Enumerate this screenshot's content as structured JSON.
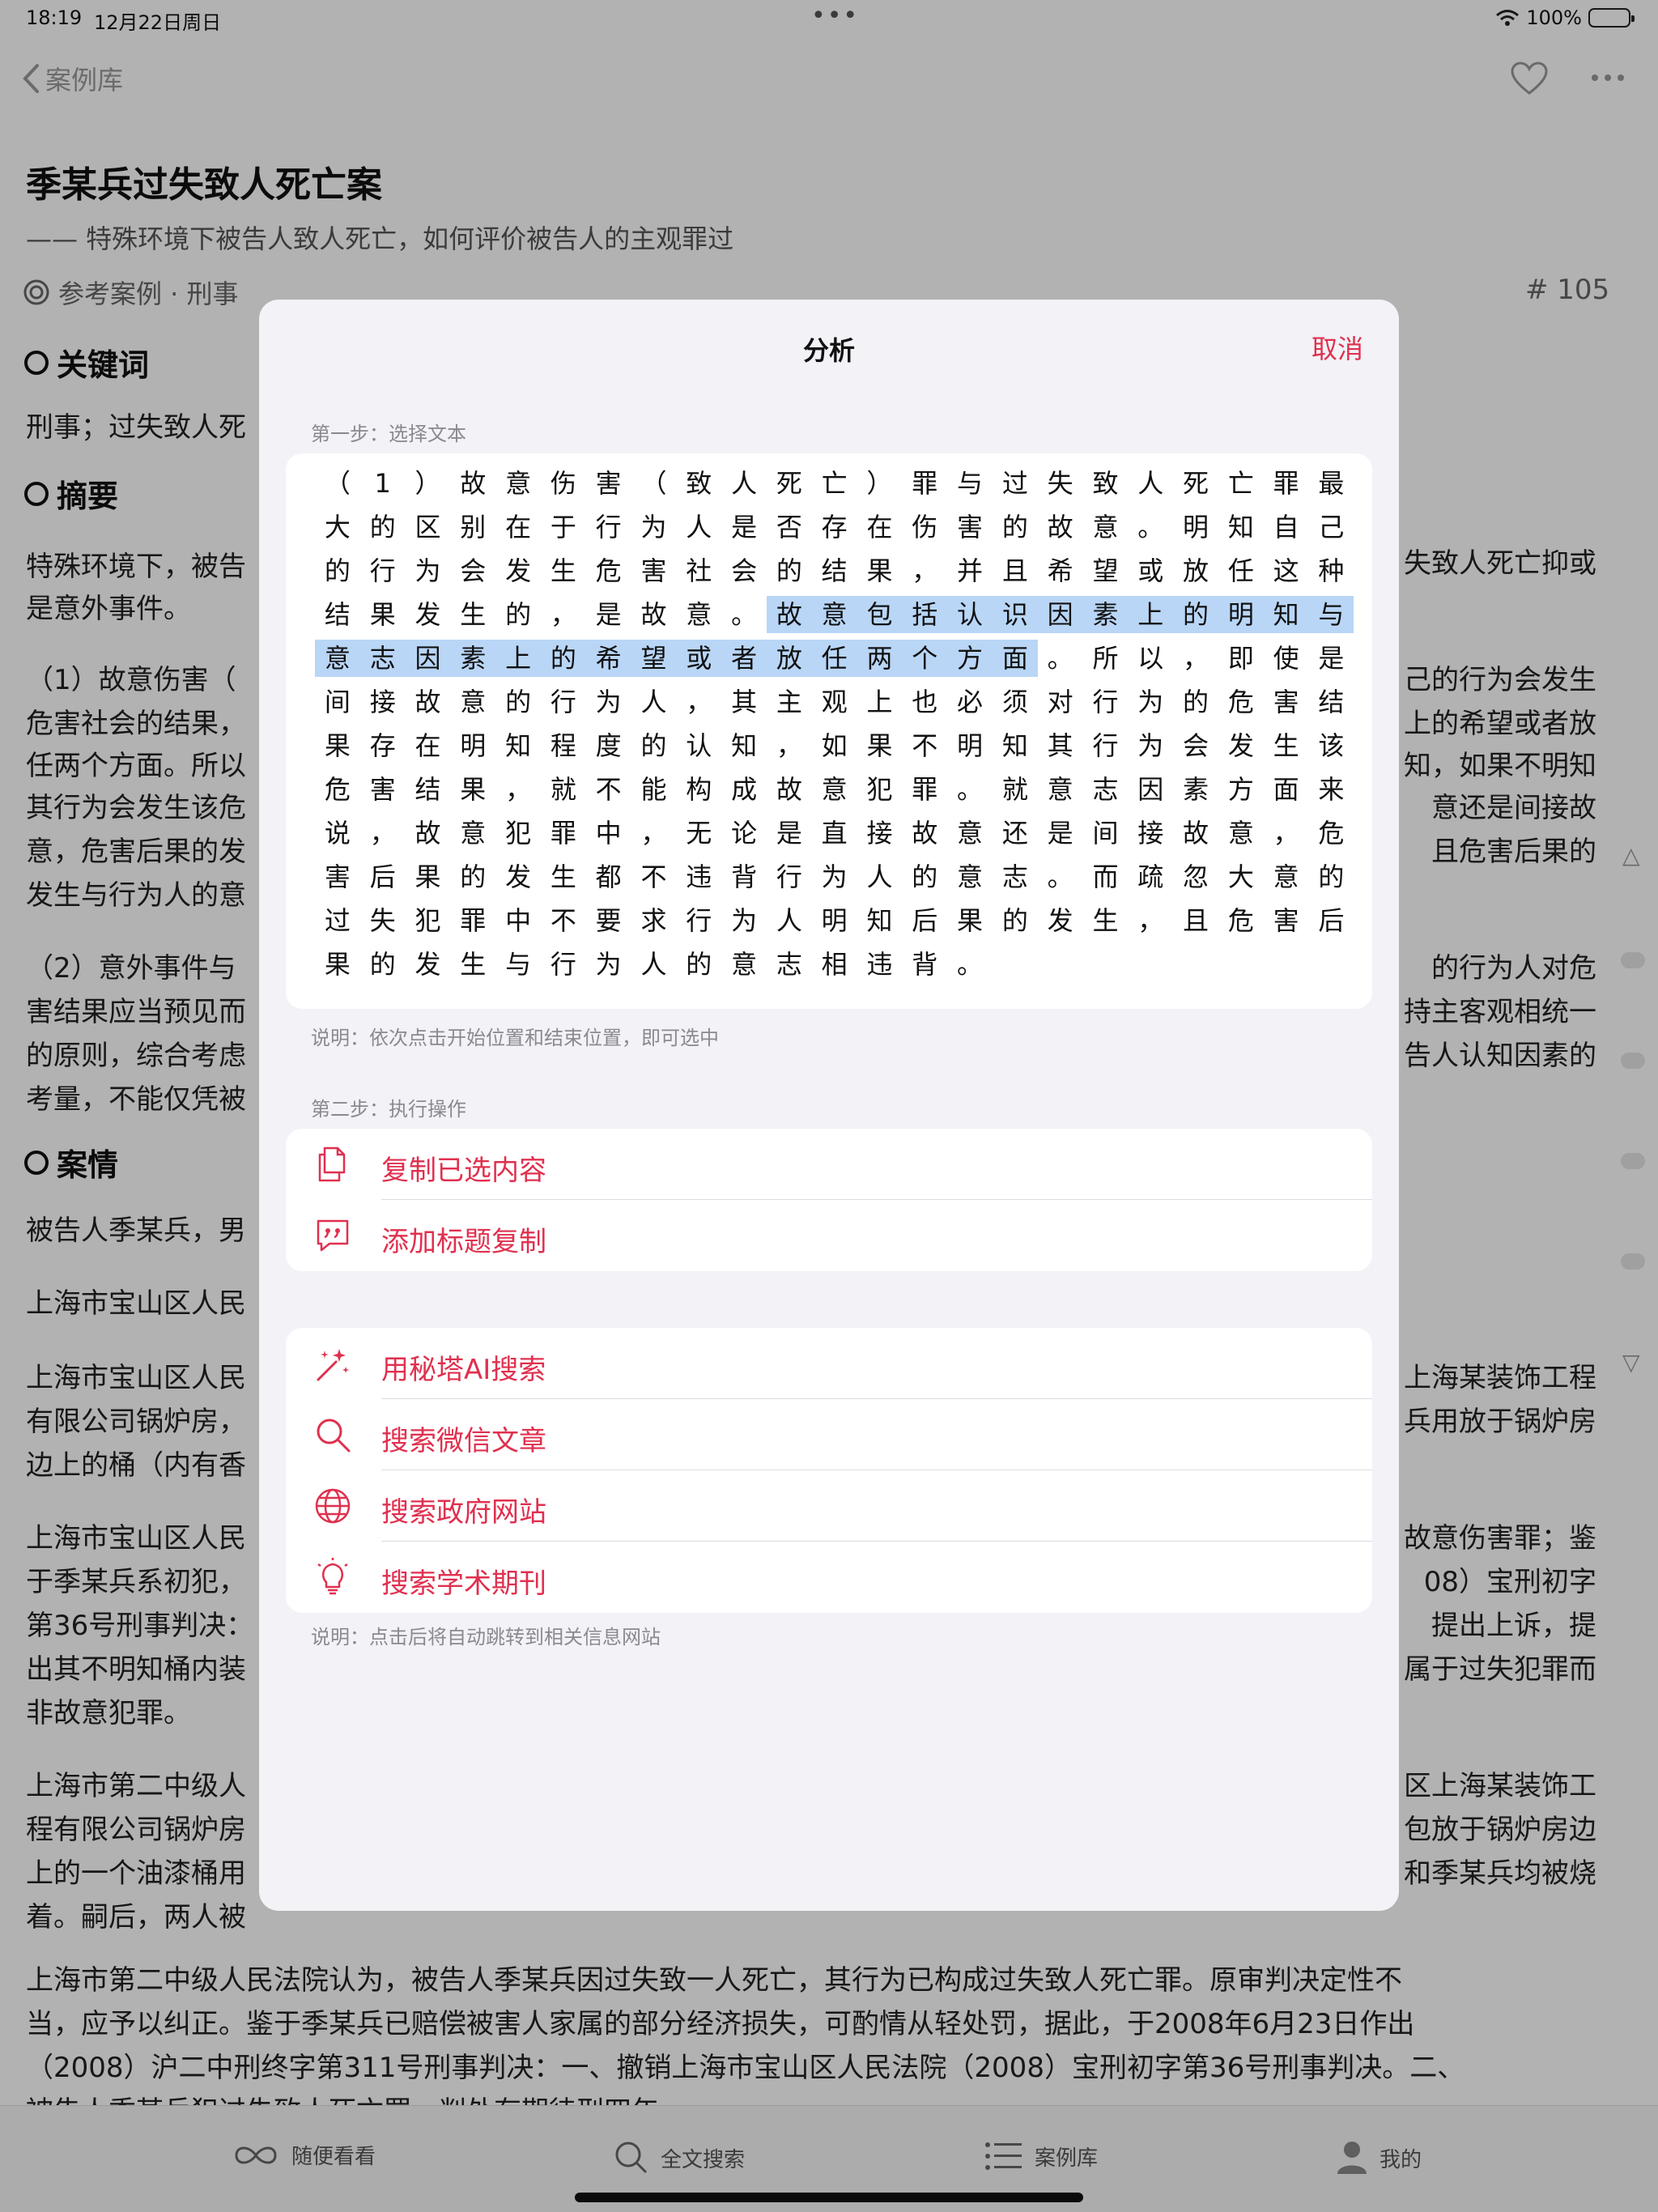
{
  "status": {
    "time": "18:19",
    "date": "12月22日周日",
    "battery": "100%"
  },
  "nav": {
    "back_label": "案例库"
  },
  "article": {
    "title": "季某兵过失致人死亡案",
    "subtitle": "—— 特殊环境下被告人致人死亡，如何评价被告人的主观罪过",
    "meta": "参考案例 · 刑事",
    "number": "# 105",
    "sections": {
      "keywords": "关键词",
      "abstract": "摘要",
      "facts": "案情"
    },
    "left_lines": [
      "刑事；过失致人死",
      "特殊环境下，被告",
      "是意外事件。",
      "（1）故意伤害（",
      "危害社会的结果，",
      "任两个方面。所以",
      "其行为会发生该危",
      "意，危害后果的发",
      "发生与行为人的意",
      "（2）意外事件与",
      "害结果应当预见而",
      "的原则，综合考虑",
      "考量，不能仅凭被",
      "被告人季某兵，男",
      "上海市宝山区人民",
      "上海市宝山区人民",
      "有限公司锅炉房，",
      "边上的桶（内有香",
      "上海市宝山区人民",
      "于季某兵系初犯，",
      "第36号刑事判决：",
      "出其不明知桶内装",
      "非故意犯罪。",
      "上海市第二中级人",
      "程有限公司锅炉房",
      "上的一个油漆桶用",
      "着。嗣后，两人被"
    ],
    "right_lines": [
      "失致人死亡抑或",
      "己的行为会发生",
      "上的希望或者放",
      "知，如果不明知",
      "意还是间接故",
      "且危害后果的",
      "的行为人对危",
      "持主客观相统一",
      "告人认知因素的",
      "上海某装饰工程",
      "兵用放于锅炉房",
      "故意伤害罪；鉴",
      "08）宝刑初字",
      "提出上诉，提",
      "属于过失犯罪而",
      "区上海某装饰工",
      "包放于锅炉房边",
      "和季某兵均被烧"
    ],
    "full_lines": [
      "上海市第二中级人民法院认为，被告人季某兵因过失致一人死亡，其行为已构成过失致人死亡罪。原审判决定性不",
      "当，应予以纠正。鉴于季某兵已赔偿被害人家属的部分经济损失，可酌情从轻处罚，据此，于2008年6月23日作出",
      "（2008）沪二中刑终字第311号刑事判决：一、撤销上海市宝山区人民法院（2008）宝刑初字第36号刑事判决。二、",
      "被告人季某兵犯过失致人死亡罪，判处有期徒刑四年。"
    ]
  },
  "modal": {
    "title": "分析",
    "cancel": "取消",
    "step1_label": "第一步：选择文本",
    "text_lines": [
      "（1）故意伤害（致人死亡）罪与过失致人死亡罪最",
      "大的区别在于行为人是否存在伤害的故意。明知自己",
      "的行为会发生危害社会的结果，并且希望或放任这种",
      "结果发生的，是故意。故意包括认识因素上的明知与",
      "意志因素上的希望或者放任两个方面。所以，即使是",
      "间接故意的行为人，其主观上也必须对行为的危害结",
      "果存在明知程度的认知，如果不明知其行为会发生该",
      "危害结果，就不能构成故意犯罪。就意志因素方面来",
      "说，故意犯罪中，无论是直接故意还是间接故意，危",
      "害后果的发生都不违背行为人的意志。而疏忽大意的",
      "过失犯罪中不要求行为人明知后果的发生，且危害后",
      "果的发生与行为人的意志相违背。"
    ],
    "selected_text": "故意包括认识因素上的明知与意志因素上的希望或者放任两个方面",
    "step1_hint": "说明：依次点击开始位置和结束位置，即可选中",
    "step2_label": "第二步：执行操作",
    "actions": [
      {
        "label": "复制已选内容",
        "icon": "copy-icon"
      },
      {
        "label": "添加标题复制",
        "icon": "quote-bubble-icon"
      }
    ],
    "searches": [
      {
        "label": "用秘塔AI搜索",
        "icon": "sparkles-icon"
      },
      {
        "label": "搜索微信文章",
        "icon": "search-icon"
      },
      {
        "label": "搜索政府网站",
        "icon": "globe-icon"
      },
      {
        "label": "搜索学术期刊",
        "icon": "lightbulb-icon"
      }
    ],
    "search_hint": "说明：点击后将自动跳转到相关信息网站"
  },
  "tabbar": [
    {
      "label": "随便看看",
      "icon": "infinity-icon"
    },
    {
      "label": "全文搜索",
      "icon": "search-icon"
    },
    {
      "label": "案例库",
      "icon": "list-icon"
    },
    {
      "label": "我的",
      "icon": "person-icon"
    }
  ],
  "colors": {
    "accent": "#e0304f",
    "selection": "#b9d6f7",
    "modal_bg": "#f2f2f7"
  }
}
